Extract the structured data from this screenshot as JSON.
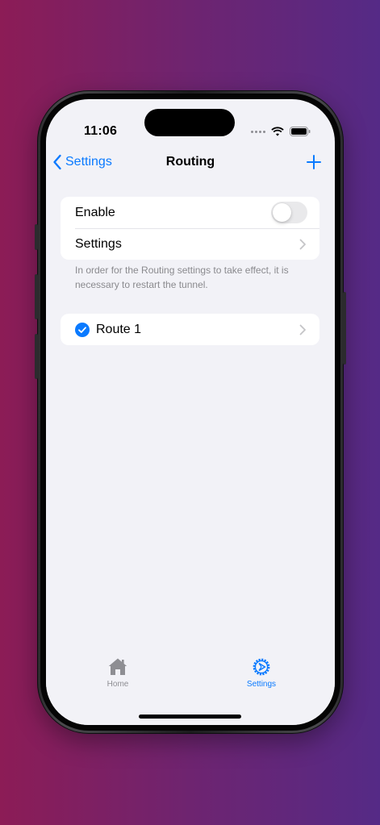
{
  "status_bar": {
    "time": "11:06"
  },
  "nav": {
    "back_label": "Settings",
    "title": "Routing"
  },
  "routing": {
    "enable_label": "Enable",
    "enable_on": false,
    "settings_label": "Settings",
    "footnote": "In order for the Routing settings to take effect, it is necessary to restart the tunnel."
  },
  "routes": [
    {
      "name": "Route 1",
      "selected": true
    }
  ],
  "tab_bar": {
    "tabs": [
      {
        "label": "Home",
        "icon": "house-icon",
        "active": false
      },
      {
        "label": "Settings",
        "icon": "gear-icon",
        "active": true
      }
    ]
  },
  "colors": {
    "accent": "#0a7aff",
    "background": "#f2f2f7",
    "inactive": "#8e8e93"
  }
}
